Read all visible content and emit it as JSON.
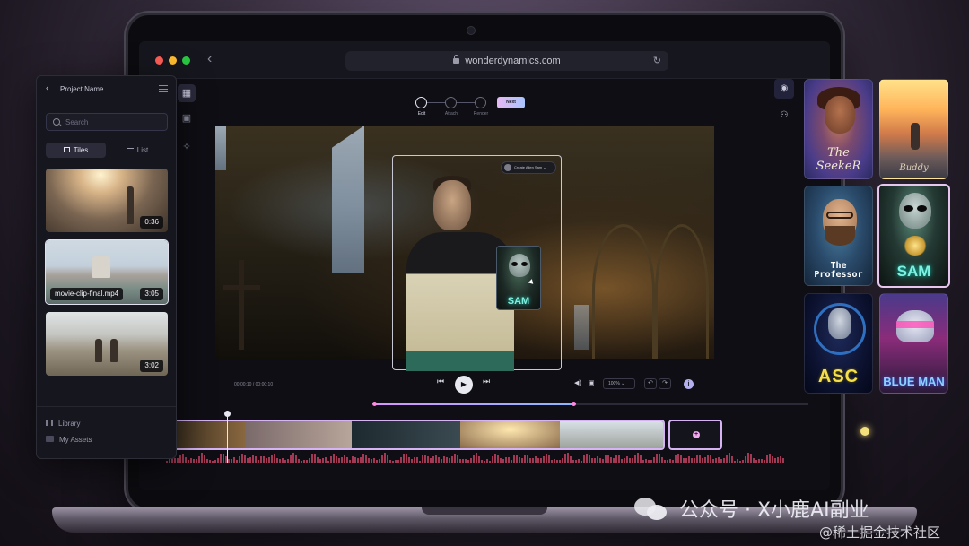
{
  "browser": {
    "url": "wonderdynamics.com"
  },
  "stepper": {
    "steps": [
      {
        "label": "Edit",
        "active": true
      },
      {
        "label": "Attach",
        "active": false
      },
      {
        "label": "Render",
        "active": false
      }
    ],
    "next_label": "Next"
  },
  "video": {
    "track_pill_label": "Create Alien Sam",
    "overlay_character": "SAM"
  },
  "controls": {
    "timecode": "00:00:10 / 00:00:10",
    "zoom": "100%"
  },
  "side_panel": {
    "title": "Project Name",
    "search_placeholder": "Search",
    "view_tiles": "Tiles",
    "view_list": "List",
    "clips": [
      {
        "name": "",
        "duration": "0:36"
      },
      {
        "name": "movie-clip-final.mp4",
        "duration": "3:05"
      },
      {
        "name": "",
        "duration": "3:02"
      }
    ],
    "links": [
      "Library",
      "My Assets"
    ]
  },
  "characters": [
    {
      "label": "The SeekeR"
    },
    {
      "label": "Buddy"
    },
    {
      "label": "The Professor"
    },
    {
      "label": "SAM"
    },
    {
      "label": "ASC"
    },
    {
      "label": "BLUE MAN"
    }
  ],
  "watermark": {
    "main": "公众号 · X小鹿AI副业",
    "sub": "@稀土掘金技术社区"
  },
  "colors": {
    "accent": "#d6b4f4",
    "next_gradient_start": "#e6b8f2",
    "next_gradient_end": "#a8c4ff",
    "sam_label": "#7ff0e2",
    "asc_label": "#f5df4a"
  }
}
